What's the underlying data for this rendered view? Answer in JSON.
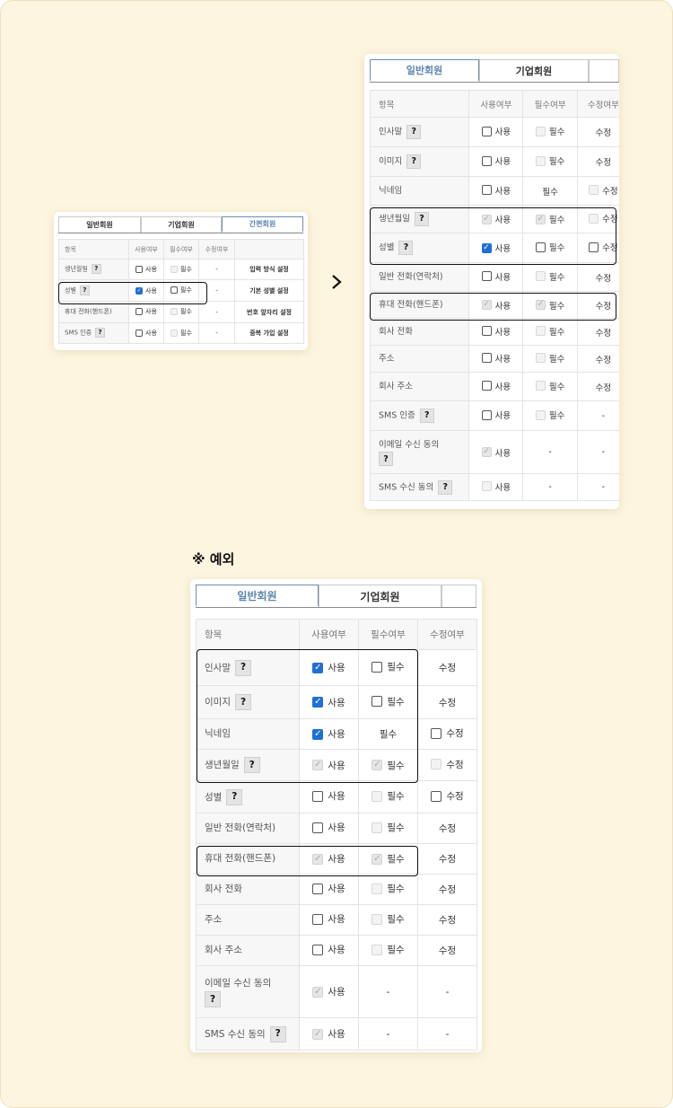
{
  "tabs": {
    "general": "일반회원",
    "company": "기업회원",
    "simple": "간편회원"
  },
  "headers": {
    "item": "항목",
    "use": "사용여부",
    "required": "필수여부",
    "editable": "수정여부"
  },
  "labels": {
    "use": "사용",
    "required": "필수",
    "edit": "수정",
    "dash": "-",
    "help": "?"
  },
  "note": "※ 예외",
  "left_table": {
    "rows": [
      {
        "label": "생년월일",
        "use": "off",
        "req": "dis",
        "edit": "-",
        "action": "입력 방식 설정"
      },
      {
        "label": "성별",
        "use": "on",
        "req": "off",
        "edit": "-",
        "action": "기본 성별 설정"
      },
      {
        "label": "휴대 전화(핸드폰)",
        "use": "off",
        "req": "dis",
        "edit": "-",
        "action": "번호 앞자리 설정"
      },
      {
        "label": "SMS 인증",
        "use": "off",
        "req": "dis",
        "edit": "-",
        "action": "중복 가입 설정"
      }
    ]
  },
  "right_table": {
    "rows": [
      {
        "label": "인사말",
        "use": "off",
        "req": "dis",
        "edit": "수정"
      },
      {
        "label": "이미지",
        "use": "off",
        "req": "dis",
        "edit": "수정"
      },
      {
        "label": "닉네임",
        "use": "off",
        "req": "필수",
        "edit": "dis"
      },
      {
        "label": "생년월일",
        "use": "dison",
        "req": "dison",
        "edit": "dis"
      },
      {
        "label": "성별",
        "use": "on",
        "req": "off",
        "edit": "off"
      },
      {
        "label": "일반 전화(연락처)",
        "use": "off",
        "req": "dis",
        "edit": "수정"
      },
      {
        "label": "휴대 전화(핸드폰)",
        "use": "dison",
        "req": "dison",
        "edit": "수정"
      },
      {
        "label": "회사 전화",
        "use": "off",
        "req": "dis",
        "edit": "수정"
      },
      {
        "label": "주소",
        "use": "off",
        "req": "dis",
        "edit": "수정"
      },
      {
        "label": "회사 주소",
        "use": "off",
        "req": "dis",
        "edit": "수정"
      },
      {
        "label": "SMS 인증",
        "use": "off",
        "req": "dis",
        "edit": "-"
      },
      {
        "label": "이메일 수신 동의",
        "use": "dison",
        "req": "-",
        "edit": "-"
      },
      {
        "label": "SMS 수신 동의",
        "use": "dis",
        "req": "-",
        "edit": "-"
      }
    ]
  },
  "bottom_table": {
    "rows": [
      {
        "label": "인사말",
        "use": "on",
        "req": "off",
        "edit": "수정"
      },
      {
        "label": "이미지",
        "use": "on",
        "req": "off",
        "edit": "수정"
      },
      {
        "label": "닉네임",
        "use": "on",
        "req": "필수",
        "edit": "off"
      },
      {
        "label": "생년월일",
        "use": "dison",
        "req": "dison",
        "edit": "dis"
      },
      {
        "label": "성별",
        "use": "off",
        "req": "dis",
        "edit": "off"
      },
      {
        "label": "일반 전화(연락처)",
        "use": "off",
        "req": "dis",
        "edit": "수정"
      },
      {
        "label": "휴대 전화(핸드폰)",
        "use": "dison",
        "req": "dison",
        "edit": "수정"
      },
      {
        "label": "회사 전화",
        "use": "off",
        "req": "dis",
        "edit": "수정"
      },
      {
        "label": "주소",
        "use": "off",
        "req": "dis",
        "edit": "수정"
      },
      {
        "label": "회사 주소",
        "use": "off",
        "req": "dis",
        "edit": "수정"
      },
      {
        "label": "이메일 수신 동의",
        "use": "dison",
        "req": "-",
        "edit": "-"
      },
      {
        "label": "SMS 수신 동의",
        "use": "dison",
        "req": "-",
        "edit": "-"
      }
    ]
  }
}
